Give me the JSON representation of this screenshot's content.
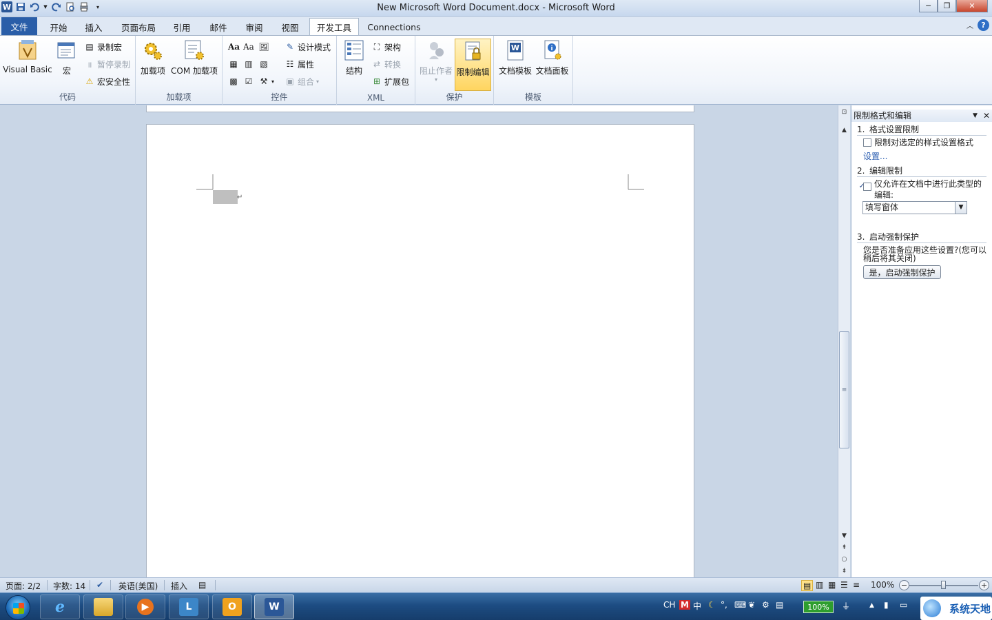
{
  "window": {
    "title": "New Microsoft Word Document.docx - Microsoft Word",
    "controls": [
      "─",
      "❐",
      "✕"
    ]
  },
  "qat": {
    "icons": [
      "word-icon",
      "save-icon",
      "undo-icon",
      "redo-icon",
      "print-preview-icon",
      "customize-qat-icon"
    ]
  },
  "tabs": [
    {
      "label": "文件"
    },
    {
      "label": "开始"
    },
    {
      "label": "插入"
    },
    {
      "label": "页面布局"
    },
    {
      "label": "引用"
    },
    {
      "label": "邮件"
    },
    {
      "label": "审阅"
    },
    {
      "label": "视图"
    },
    {
      "label": "开发工具"
    },
    {
      "label": "Connections"
    }
  ],
  "active_tab": "开发工具",
  "ribbon": {
    "code": {
      "label": "代码",
      "visual_basic": "Visual Basic",
      "macro": "宏",
      "record_macro": "录制宏",
      "pause_recording": "暂停录制",
      "macro_security": "宏安全性"
    },
    "addins": {
      "label": "加载项",
      "addins": "加载项",
      "com_addins": "COM 加载项"
    },
    "controls": {
      "label": "控件",
      "rich_text": "Aa",
      "plain_text": "Aa",
      "design_mode": "设计模式",
      "properties": "属性",
      "group": "组合"
    },
    "xml": {
      "label": "XML",
      "structure": "结构",
      "schema": "架构",
      "transform": "转换",
      "expansion_packs": "扩展包"
    },
    "protect": {
      "label": "保护",
      "block_authors": "阻止作者",
      "restrict_editing": "限制编辑"
    },
    "templates": {
      "label": "模板",
      "document_template": "文档模板",
      "document_panel": "文档面板"
    }
  },
  "document": {
    "paragraph_mark": "↵"
  },
  "task_pane": {
    "title": "限制格式和编辑",
    "section1": {
      "num": "1.",
      "title": "格式设置限制",
      "checkbox_label": "限制对选定的样式设置格式",
      "checked": false,
      "link": "设置..."
    },
    "section2": {
      "num": "2.",
      "title": "编辑限制",
      "checkbox_label": "仅允许在文档中进行此类型的编辑:",
      "checked": true,
      "dropdown_value": "填写窗体"
    },
    "section3": {
      "num": "3.",
      "title": "启动强制保护",
      "text": "您是否准备应用这些设置?(您可以稍后将其关闭)",
      "button": "是，启动强制保护"
    }
  },
  "status_bar": {
    "page": "页面: 2/2",
    "words": "字数: 14",
    "language": "英语(美国)",
    "mode": "插入",
    "zoom": "100%"
  },
  "taskbar": {
    "apps": [
      {
        "name": "ie-icon"
      },
      {
        "name": "explorer-icon"
      },
      {
        "name": "media-player-icon"
      },
      {
        "name": "lync-icon"
      },
      {
        "name": "outlook-icon"
      },
      {
        "name": "word-icon"
      }
    ],
    "tray": {
      "lang": "CH",
      "ime": "中",
      "battery": "100%"
    },
    "watermark": "系统天地"
  }
}
